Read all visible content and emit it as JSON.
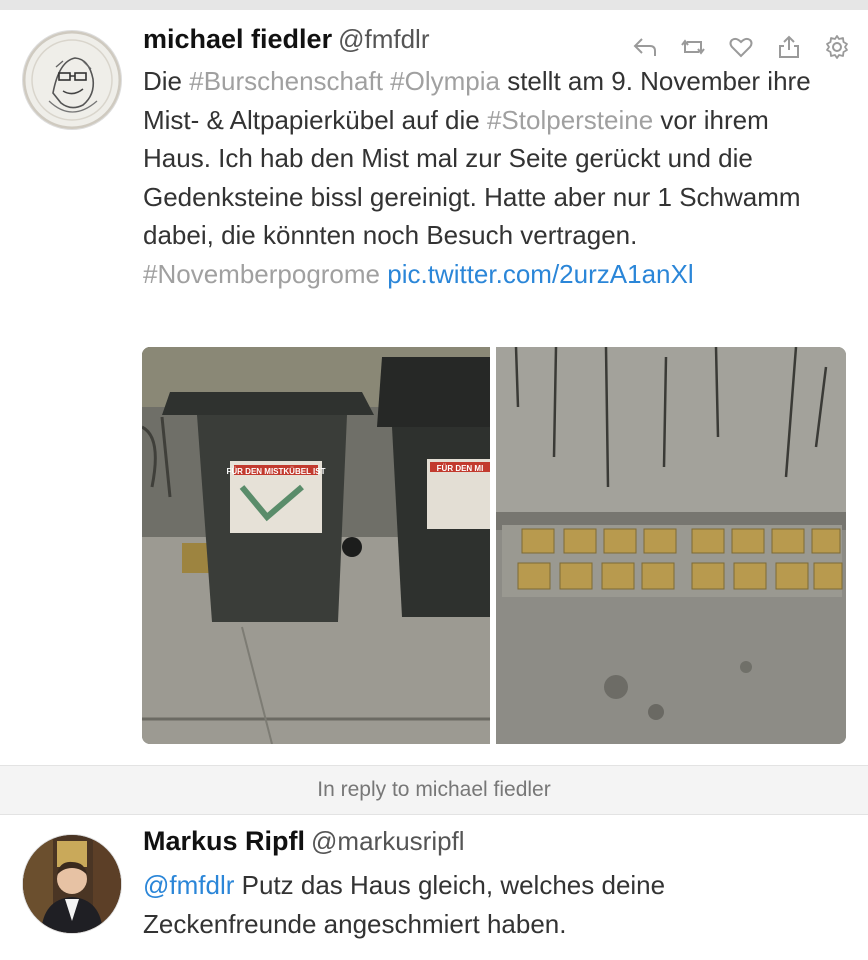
{
  "tweet1": {
    "name": "michael fiedler",
    "handle": "@fmfdlr",
    "text": {
      "p1": "Die ",
      "tag1": "#Burschenschaft",
      "p2": " ",
      "tag2": "#Olympia",
      "p3": " stellt am 9. November ihre Mist- & Altpapierkübel auf die ",
      "tag3": "#Stolpersteine",
      "p4": " vor ihrem Haus. Ich hab den Mist mal zur Seite gerückt und die Gedenksteine bissl gereinigt. Hatte aber nur 1 Schwamm dabei, die könnten noch Besuch vertragen. ",
      "tag4": "#Novemberpogrome",
      "p5": " ",
      "link": "pic.twitter.com/2urzA1anXl"
    },
    "actions": [
      "reply-icon",
      "retweet-icon",
      "like-icon",
      "share-icon",
      "settings-icon"
    ],
    "media_sign_left": "FÜR DEN MISTKÜBEL IST",
    "media_sign_right": "FÜR DEN MI"
  },
  "reply_context": "In reply to michael fiedler",
  "tweet2": {
    "name": "Markus Ripfl",
    "handle": "@markusripfl",
    "mention": "@fmfdlr",
    "text": " Putz das Haus gleich, welches deine Zeckenfreunde angeschmiert haben."
  },
  "colors": {
    "hashtag": "#a0a0a0",
    "link": "#2b86d8",
    "reply_bar": "#f4f4f4"
  }
}
